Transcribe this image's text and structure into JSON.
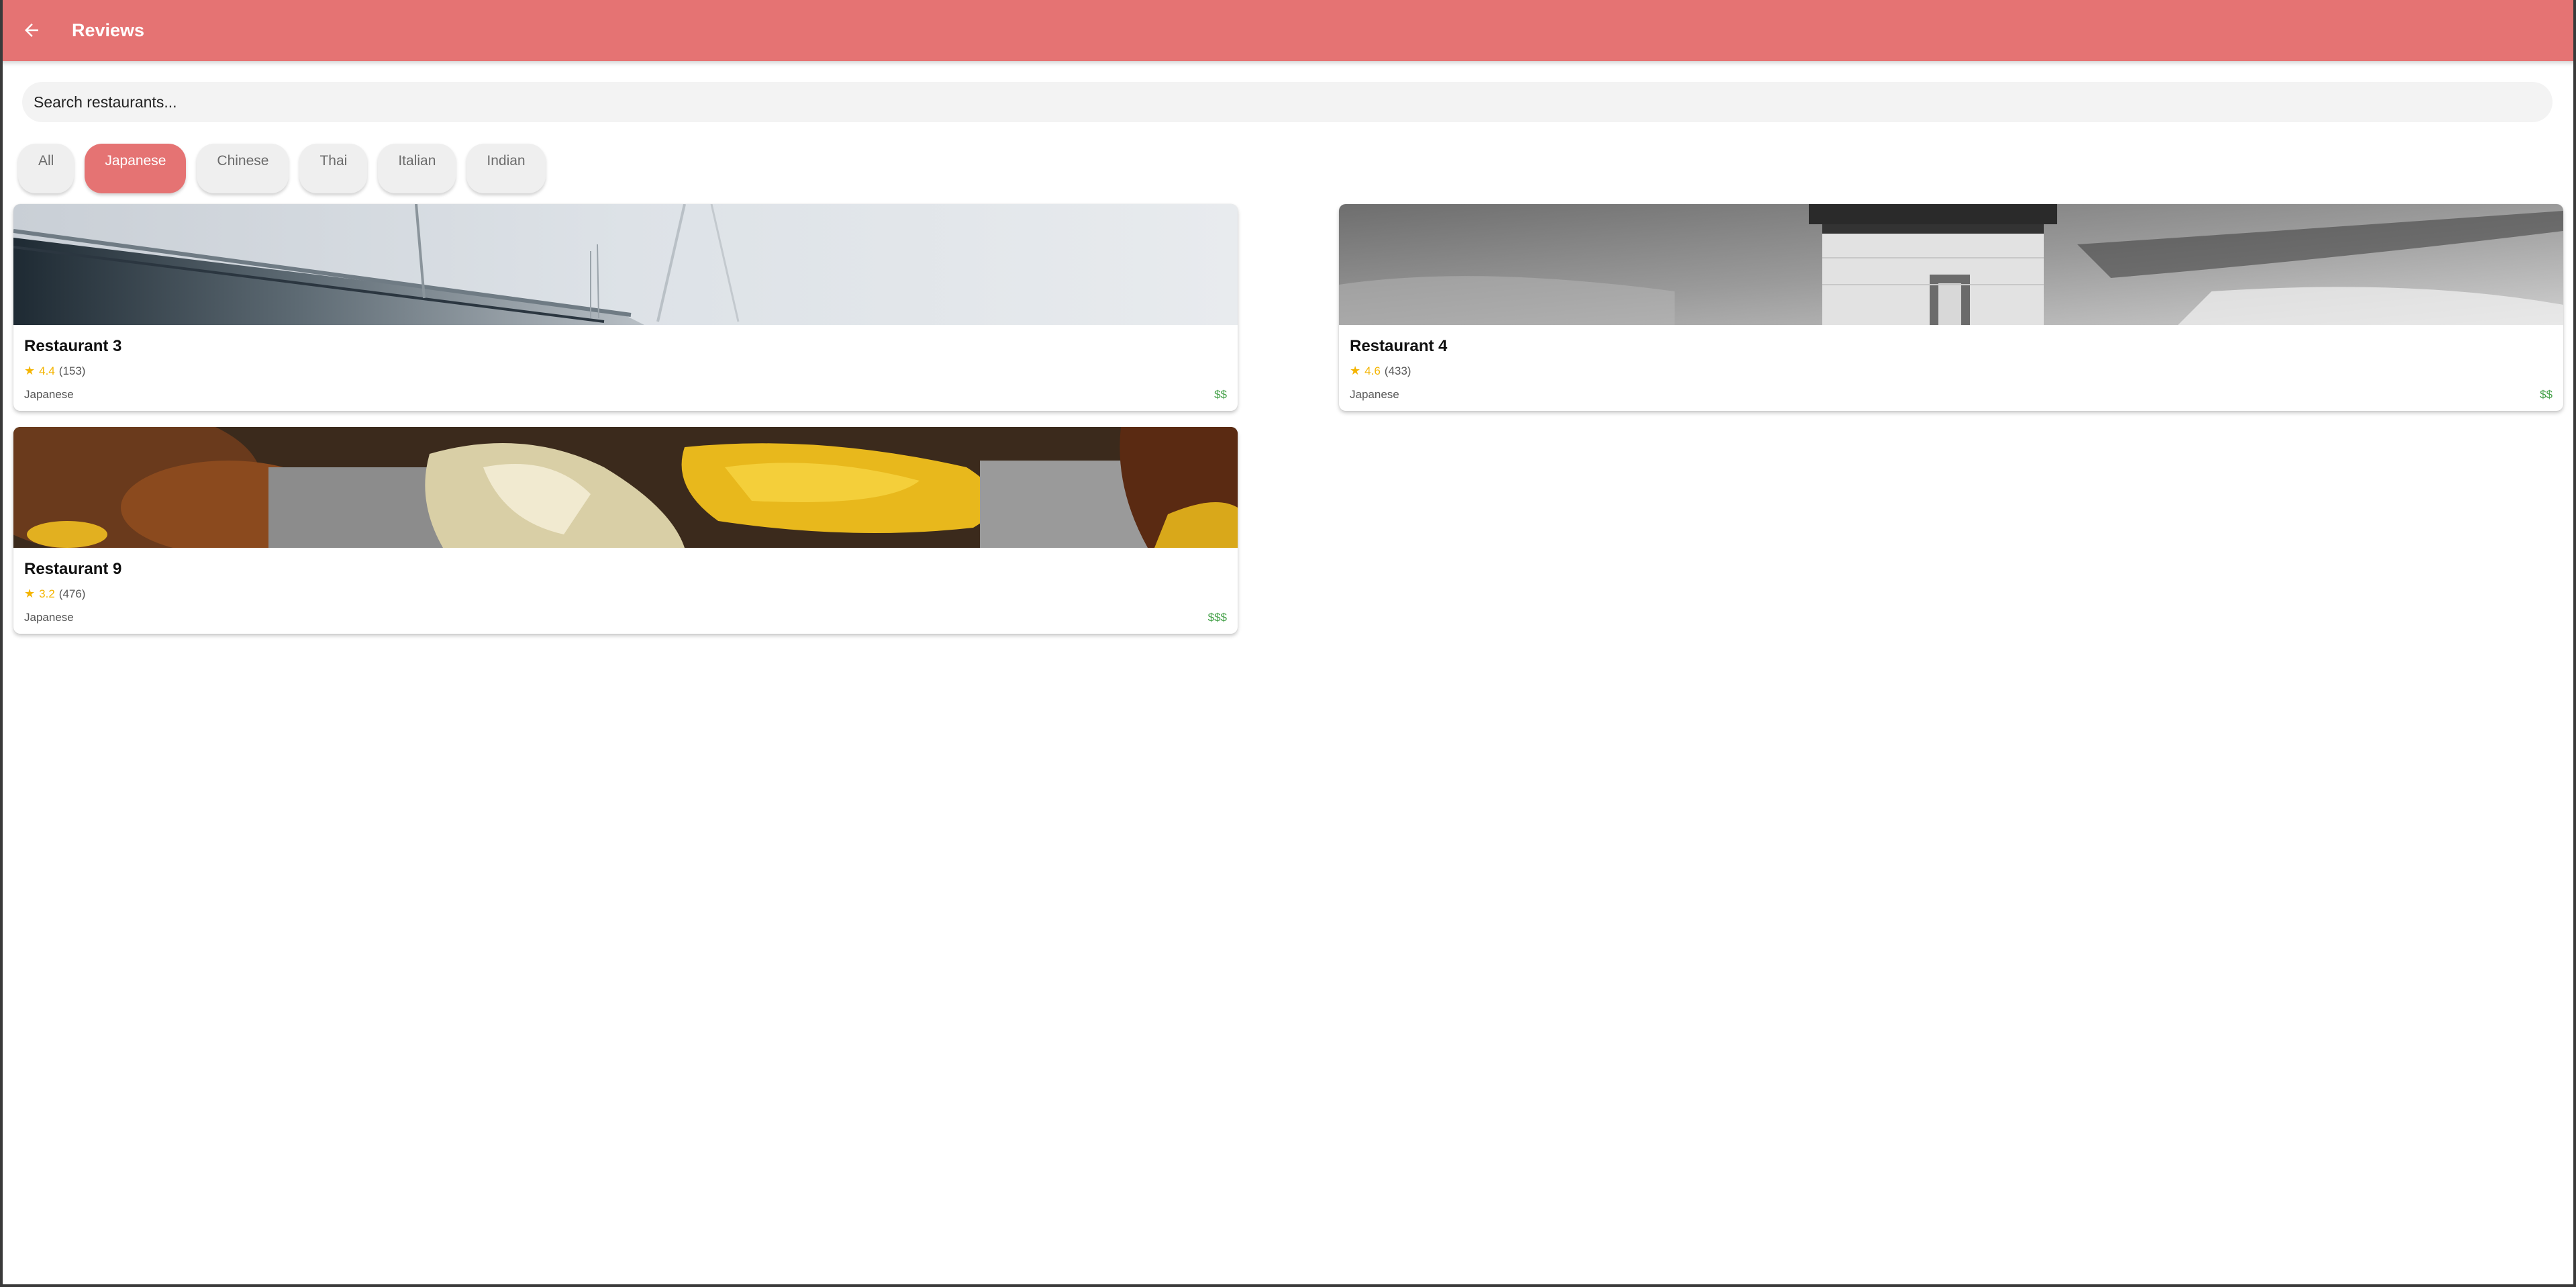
{
  "app": {
    "title": "Reviews",
    "accent_color": "#e57373"
  },
  "search": {
    "placeholder": "Search restaurants...",
    "value": ""
  },
  "filters": {
    "selected": "Japanese",
    "chips": [
      "All",
      "Japanese",
      "Chinese",
      "Thai",
      "Italian",
      "Indian"
    ]
  },
  "restaurants": [
    {
      "name": "Restaurant 3",
      "rating": "4.4",
      "reviews": "(153)",
      "cuisine": "Japanese",
      "price": "$$",
      "image": "bridge-photo"
    },
    {
      "name": "Restaurant 4",
      "rating": "4.6",
      "reviews": "(433)",
      "cuisine": "Japanese",
      "price": "$$",
      "image": "lighthouse-photo"
    },
    {
      "name": "Restaurant 9",
      "rating": "3.2",
      "reviews": "(476)",
      "cuisine": "Japanese",
      "price": "$$$",
      "image": "food-photo"
    }
  ],
  "icons": {
    "back": "back-arrow-icon",
    "star": "star-icon"
  }
}
